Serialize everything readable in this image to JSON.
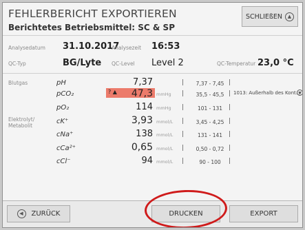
{
  "header": {
    "title": "FEHLERBERICHT EXPORTIEREN",
    "subtitle": "Berichtetes Betriebsmittel: SC & SP",
    "close_label": "SCHLIEßEN",
    "close_icon": "chevron-up-icon"
  },
  "info": {
    "analysis_date_label": "Analysedatum",
    "analysis_date": "31.10.2017",
    "analysis_time_label": "Analysezeit",
    "analysis_time": "16:53",
    "qc_type_label": "QC-Typ",
    "qc_type": "BG/Lyte",
    "qc_level_label": "QC-Level",
    "qc_level": "Level 2",
    "qc_temp_label": "QC-Temperatur",
    "qc_temp": "23,0 °C"
  },
  "groups": {
    "bloodgas": "Blutgas",
    "electrolyte": "Elektrolyt/\nMetabolit"
  },
  "results": [
    {
      "param": "pH",
      "value": "7,37",
      "unit": "",
      "range": "7,37 - 7,45"
    },
    {
      "param": "pCO₂",
      "flag": "? ▲",
      "value": "47,3",
      "unit": "mmHg",
      "range": "35,5 - 45,5",
      "note": "1013: Außerhalb des Kont..."
    },
    {
      "param": "pO₂",
      "value": "114",
      "unit": "mmHg",
      "range": "101 - 131"
    },
    {
      "param": "cK⁺",
      "value": "3,93",
      "unit": "mmol/L",
      "range": "3,45 - 4,25"
    },
    {
      "param": "cNa⁺",
      "value": "138",
      "unit": "mmol/L",
      "range": "131 - 141"
    },
    {
      "param": "cCa²⁺",
      "value": "0,65",
      "unit": "mmol/L",
      "range": "0,50 - 0,72"
    },
    {
      "param": "cCl⁻",
      "value": "94",
      "unit": "mmol/L",
      "range": "90 - 100"
    }
  ],
  "sep": "|",
  "highlight_color": "#ec7b6b",
  "annotation_color": "#cf1b1b",
  "footer": {
    "back_label": "ZURÜCK",
    "back_icon": "chevron-left-icon",
    "print_label": "DRUCKEN",
    "export_label": "EXPORT"
  }
}
